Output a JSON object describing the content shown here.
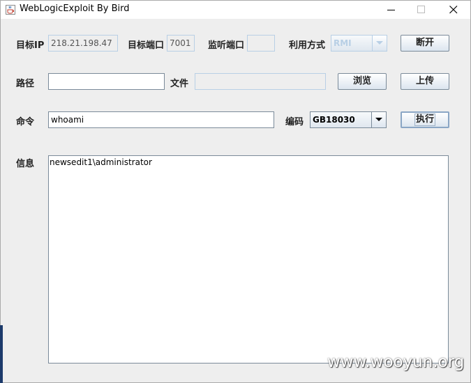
{
  "window": {
    "title": "WebLogicExploit By Bird",
    "icon": "java-cup-icon"
  },
  "row1": {
    "target_ip_label": "目标IP",
    "target_ip_value": "218.21.198.47",
    "target_port_label": "目标端口",
    "target_port_value": "7001",
    "listen_port_label": "监听端口",
    "listen_port_value": "",
    "method_label": "利用方式",
    "method_value": "RMI",
    "disconnect_label": "断开"
  },
  "row2": {
    "path_label": "路径",
    "path_value": "",
    "file_label": "文件",
    "file_value": "",
    "browse_label": "浏览",
    "upload_label": "上传"
  },
  "row3": {
    "command_label": "命令",
    "command_value": "whoami",
    "encoding_label": "编码",
    "encoding_value": "GB18030",
    "execute_label": "执行"
  },
  "info": {
    "label": "信息",
    "output": "newsedit1\\administrator"
  },
  "watermark": "www.wooyun.org"
}
